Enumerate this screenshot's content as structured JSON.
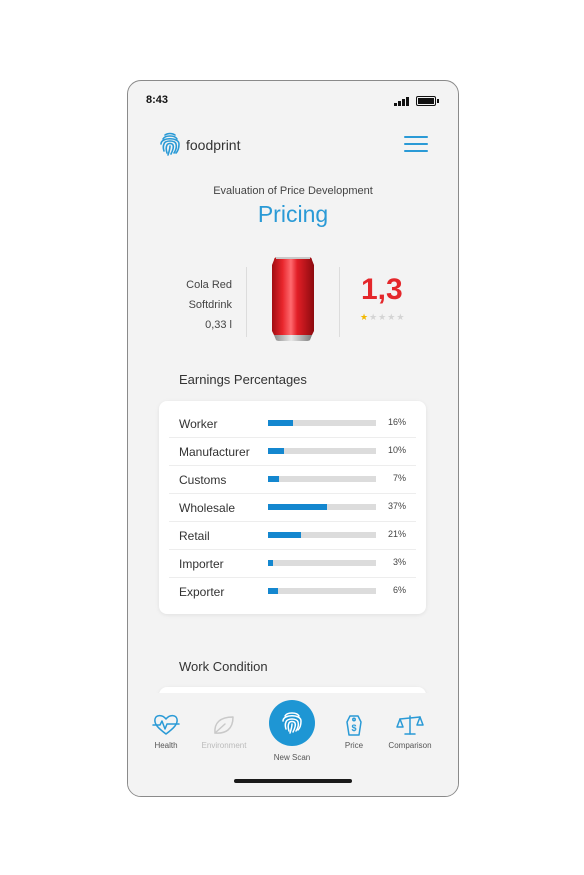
{
  "status_bar": {
    "time": "8:43"
  },
  "header": {
    "brand": "foodprint",
    "logo_icon": "fingerprint-icon",
    "menu_icon": "hamburger-menu-icon"
  },
  "page": {
    "subtitle": "Evaluation of Price Development",
    "title": "Pricing"
  },
  "product": {
    "name": "Cola Red",
    "category": "Softdrink",
    "volume": "0,33 l",
    "score": "1,3",
    "rating_stars": 1,
    "rating_max": 5,
    "image": "red-soda-can"
  },
  "earnings": {
    "title": "Earnings Percentages",
    "rows": [
      {
        "label": "Worker",
        "pct_text": "16%",
        "pct": 16
      },
      {
        "label": "Manufacturer",
        "pct_text": "10%",
        "pct": 10
      },
      {
        "label": "Customs",
        "pct_text": "7%",
        "pct": 7
      },
      {
        "label": "Wholesale",
        "pct_text": "37%",
        "pct": 37
      },
      {
        "label": "Retail",
        "pct_text": "21%",
        "pct": 21
      },
      {
        "label": "Importer",
        "pct_text": "3%",
        "pct": 3
      },
      {
        "label": "Exporter",
        "pct_text": "6%",
        "pct": 6
      }
    ]
  },
  "work_condition": {
    "title": "Work Condition"
  },
  "tabbar": {
    "tabs": [
      {
        "label": "Health",
        "icon": "heart-pulse-icon",
        "enabled": true
      },
      {
        "label": "Environment",
        "icon": "leaf-icon",
        "enabled": false
      },
      {
        "label": "New Scan",
        "icon": "fingerprint-icon",
        "enabled": true
      },
      {
        "label": "Price",
        "icon": "price-tag-icon",
        "enabled": true
      },
      {
        "label": "Comparison",
        "icon": "scales-icon",
        "enabled": true
      }
    ]
  },
  "colors": {
    "accent": "#2a9ad6",
    "bar": "#1487cf",
    "score": "#e4272b",
    "star": "#f2b800"
  }
}
